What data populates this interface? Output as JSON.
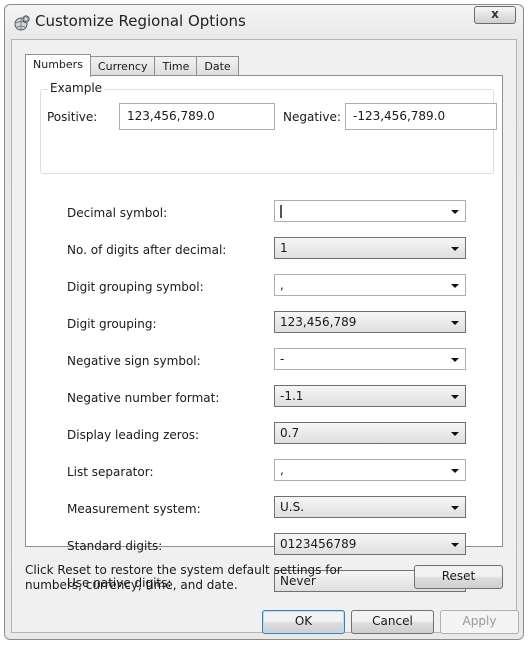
{
  "window": {
    "title": "Customize Regional Options",
    "close_glyph": "x"
  },
  "tabs": [
    {
      "label": "Numbers",
      "active": true
    },
    {
      "label": "Currency",
      "active": false
    },
    {
      "label": "Time",
      "active": false
    },
    {
      "label": "Date",
      "active": false
    }
  ],
  "example": {
    "legend": "Example",
    "positive_label": "Positive:",
    "positive_value": "123,456,789.0",
    "negative_label": "Negative:",
    "negative_value": "-123,456,789.0"
  },
  "settings": [
    {
      "label": "Decimal symbol:",
      "value": "",
      "style": "edit"
    },
    {
      "label": "No. of digits after decimal:",
      "value": "1",
      "style": "list"
    },
    {
      "label": "Digit grouping symbol:",
      "value": ",",
      "style": "edit"
    },
    {
      "label": "Digit grouping:",
      "value": "123,456,789",
      "style": "list"
    },
    {
      "label": "Negative sign symbol:",
      "value": "-",
      "style": "edit"
    },
    {
      "label": "Negative number format:",
      "value": "-1.1",
      "style": "list"
    },
    {
      "label": "Display leading zeros:",
      "value": "0.7",
      "style": "list"
    },
    {
      "label": "List separator:",
      "value": ",",
      "style": "edit"
    },
    {
      "label": "Measurement system:",
      "value": "U.S.",
      "style": "list"
    },
    {
      "label": "Standard digits:",
      "value": "0123456789",
      "style": "list"
    },
    {
      "label": "Use native digits:",
      "value": "Never",
      "style": "list"
    }
  ],
  "footer": {
    "note": "Click Reset to restore the system default settings for numbers, currency, time, and date.",
    "reset_label": "Reset",
    "ok_label": "OK",
    "cancel_label": "Cancel",
    "apply_label": "Apply"
  }
}
